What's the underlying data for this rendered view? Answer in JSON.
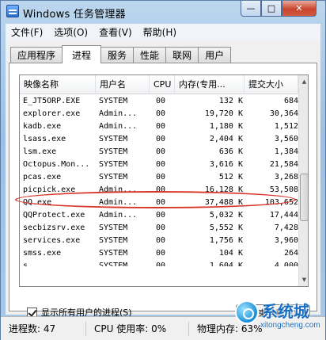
{
  "window": {
    "title": "Windows 任务管理器"
  },
  "controls": {
    "minimize": "—",
    "maximize": "□",
    "close": "✕"
  },
  "menu": [
    "文件(F)",
    "选项(O)",
    "查看(V)",
    "帮助(H)"
  ],
  "tabs": [
    "应用程序",
    "进程",
    "服务",
    "性能",
    "联网",
    "用户"
  ],
  "active_tab": "进程",
  "table": {
    "columns": [
      "映像名称",
      "用户名",
      "CPU",
      "内存(专用...",
      "提交大小"
    ],
    "rows": [
      {
        "name": "E_JT5ORP.EXE",
        "user": "SYSTEM",
        "cpu": "00",
        "mem": "132 K",
        "commit": "684"
      },
      {
        "name": "explorer.exe",
        "user": "Admin...",
        "cpu": "00",
        "mem": "19,720 K",
        "commit": "30,364"
      },
      {
        "name": "kadb.exe",
        "user": "Admin...",
        "cpu": "00",
        "mem": "1,180 K",
        "commit": "1,512"
      },
      {
        "name": "lsass.exe",
        "user": "SYSTEM",
        "cpu": "00",
        "mem": "2,404 K",
        "commit": "3,560"
      },
      {
        "name": "lsm.exe",
        "user": "SYSTEM",
        "cpu": "00",
        "mem": "636 K",
        "commit": "1,384"
      },
      {
        "name": "Octopus.Mon...",
        "user": "SYSTEM",
        "cpu": "00",
        "mem": "3,616 K",
        "commit": "21,584"
      },
      {
        "name": "pcas.exe",
        "user": "SYSTEM",
        "cpu": "00",
        "mem": "512 K",
        "commit": "3,268"
      },
      {
        "name": "picpick.exe",
        "user": "Admin...",
        "cpu": "00",
        "mem": "16,128 K",
        "commit": "53,508"
      },
      {
        "name": "QQ.exe",
        "user": "Admin...",
        "cpu": "00",
        "mem": "37,488 K",
        "commit": "103,652"
      },
      {
        "name": "QQProtect.exe",
        "user": "Admin...",
        "cpu": "00",
        "mem": "5,032 K",
        "commit": "17,444"
      },
      {
        "name": "secbizsrv.exe",
        "user": "SYSTEM",
        "cpu": "00",
        "mem": "5,552 K",
        "commit": "7,428"
      },
      {
        "name": "services.exe",
        "user": "SYSTEM",
        "cpu": "00",
        "mem": "1,756 K",
        "commit": "3,960"
      },
      {
        "name": "smss.exe",
        "user": "SYSTEM",
        "cpu": "00",
        "mem": "104 K",
        "commit": "264"
      },
      {
        "name": "s...",
        "user": "SYSTEM",
        "cpu": "00",
        "mem": "1,604 K",
        "commit": "4,000"
      }
    ]
  },
  "show_all_users_label": "显示所有用户的进程(S)",
  "show_all_users_checked": true,
  "end_process_label": "结束进程(E)",
  "status": {
    "processes": "进程数: 47",
    "cpu": "CPU 使用率: 0%",
    "memory": "物理内存: 63%"
  },
  "watermark": {
    "title": "系统城",
    "subtitle": "xitongcheng.com"
  },
  "colors": {
    "highlight_ring": "#d8352a",
    "title_bar": "#9cc0e4",
    "watermark": "#1a6fc0"
  }
}
